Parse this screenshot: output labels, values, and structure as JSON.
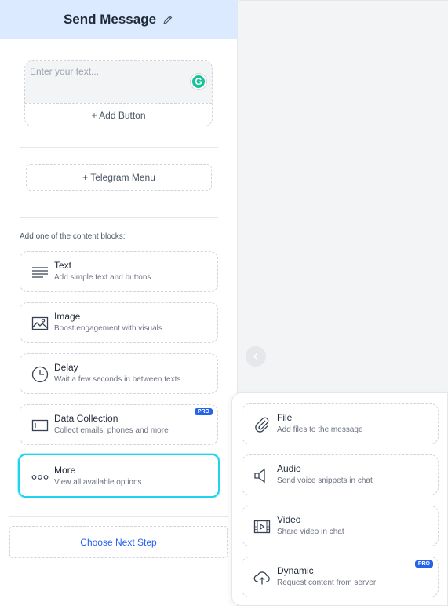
{
  "header": {
    "title": "Send Message"
  },
  "message": {
    "placeholder": "Enter your text...",
    "grammarly_letter": "G",
    "add_button": "+ Add Button"
  },
  "telegram_menu": "+ Telegram Menu",
  "content_blocks_hint": "Add one of the content blocks:",
  "blocks": [
    {
      "title": "Text",
      "desc": "Add simple text and buttons",
      "icon": "lines-icon"
    },
    {
      "title": "Image",
      "desc": "Boost engagement with visuals",
      "icon": "image-icon"
    },
    {
      "title": "Delay",
      "desc": "Wait a few seconds in between texts",
      "icon": "clock-icon"
    },
    {
      "title": "Data Collection",
      "desc": "Collect emails, phones and more",
      "icon": "input-field-icon",
      "badge": "PRO"
    },
    {
      "title": "More",
      "desc": "View all available options",
      "icon": "dots-icon"
    }
  ],
  "next_step": "Choose Next Step",
  "more_options": [
    {
      "title": "File",
      "desc": "Add files to the message",
      "icon": "paperclip-icon"
    },
    {
      "title": "Audio",
      "desc": "Send voice snippets in chat",
      "icon": "speaker-icon"
    },
    {
      "title": "Video",
      "desc": "Share video in chat",
      "icon": "video-icon"
    },
    {
      "title": "Dynamic",
      "desc": "Request content from server",
      "icon": "cloud-upload-icon",
      "badge": "PRO"
    }
  ],
  "colors": {
    "accent": "#2563eb",
    "header_bg": "#dbeafe",
    "selected_border": "#22d3ee"
  }
}
